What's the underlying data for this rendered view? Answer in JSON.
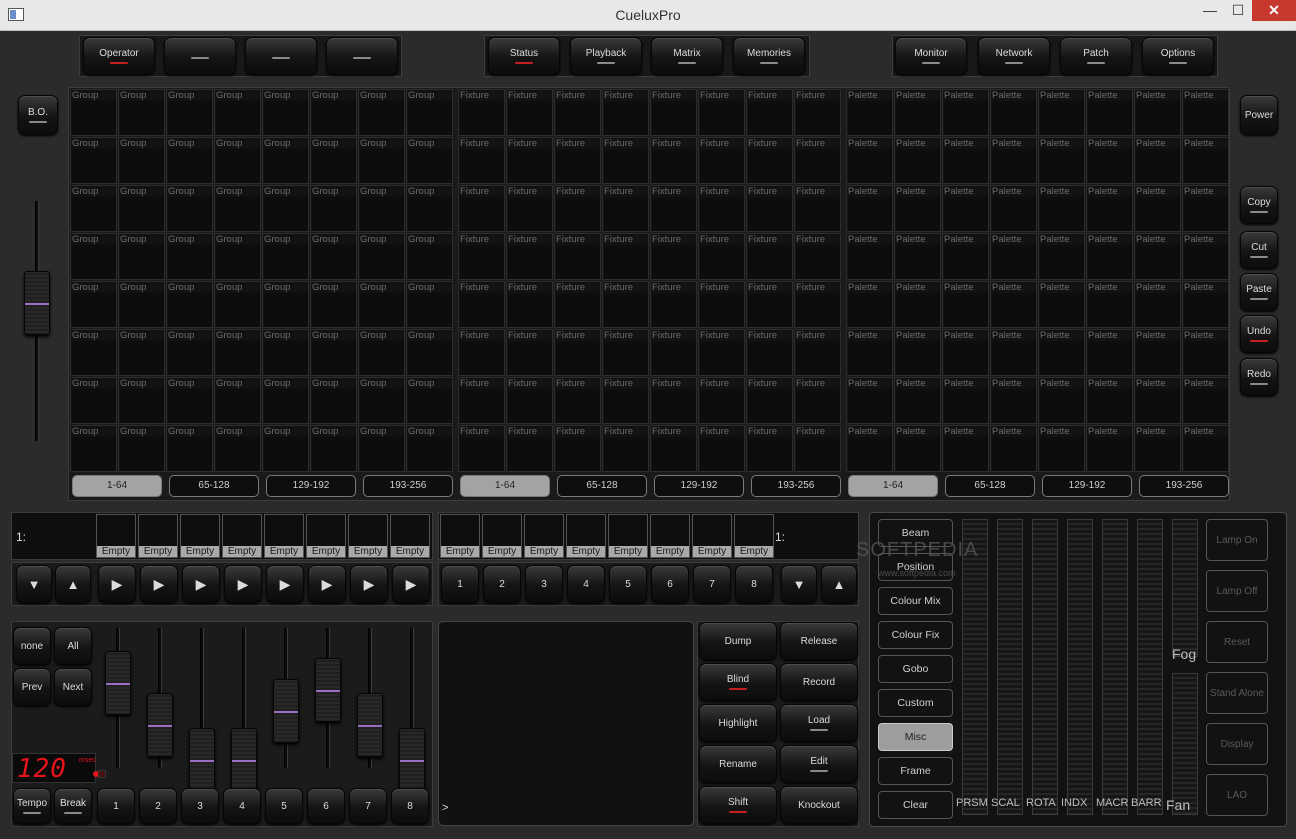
{
  "window": {
    "title": "CueluxPro",
    "min": "—",
    "max": "☐",
    "close": "✕"
  },
  "topbar": {
    "left": [
      {
        "label": "Operator",
        "ind": "red"
      },
      {
        "label": "",
        "ind": "grey"
      },
      {
        "label": "",
        "ind": "grey"
      },
      {
        "label": "",
        "ind": "grey"
      }
    ],
    "middle": [
      {
        "label": "Status",
        "ind": "red"
      },
      {
        "label": "Playback",
        "ind": "grey"
      },
      {
        "label": "Matrix",
        "ind": "grey"
      },
      {
        "label": "Memories",
        "ind": "grey"
      }
    ],
    "right": [
      {
        "label": "Monitor",
        "ind": "grey"
      },
      {
        "label": "Network",
        "ind": "grey"
      },
      {
        "label": "Patch",
        "ind": "grey"
      },
      {
        "label": "Options",
        "ind": "grey"
      }
    ]
  },
  "bo_label": "B.O.",
  "power_label": "Power",
  "edit_buttons": [
    {
      "label": "Copy",
      "ind": "grey"
    },
    {
      "label": "Cut",
      "ind": "grey"
    },
    {
      "label": "Paste",
      "ind": "grey"
    },
    {
      "label": "Undo",
      "ind": "red"
    },
    {
      "label": "Redo",
      "ind": "grey"
    }
  ],
  "grids": [
    {
      "cell_label": "Group",
      "tabs": [
        "1-64",
        "65-128",
        "129-192",
        "193-256"
      ],
      "active_tab": 0
    },
    {
      "cell_label": "Fixture",
      "tabs": [
        "1-64",
        "65-128",
        "129-192",
        "193-256"
      ],
      "active_tab": 0
    },
    {
      "cell_label": "Palette",
      "tabs": [
        "1-64",
        "65-128",
        "129-192",
        "193-256"
      ],
      "active_tab": 0
    }
  ],
  "playback_left": {
    "label": "1:",
    "slots": [
      "Empty",
      "Empty",
      "Empty",
      "Empty",
      "Empty",
      "Empty",
      "Empty",
      "Empty"
    ]
  },
  "playback_right": {
    "label": "1:",
    "slots": [
      "Empty",
      "Empty",
      "Empty",
      "Empty",
      "Empty",
      "Empty",
      "Empty",
      "Empty"
    ]
  },
  "arrows": {
    "down": "▼",
    "up": "▲",
    "play": "▶"
  },
  "number_buttons": [
    "1",
    "2",
    "3",
    "4",
    "5",
    "6",
    "7",
    "8"
  ],
  "selection_buttons": [
    "none",
    "All",
    "Prev",
    "Next"
  ],
  "fader_levels": [
    0.75,
    0.45,
    0.2,
    0.2,
    0.55,
    0.7,
    0.45,
    0.2
  ],
  "master_fader_level": 0.6,
  "tempo": {
    "value": "120",
    "unit": "msec",
    "tempo_label": "Tempo",
    "break_label": "Break"
  },
  "console": {
    "prompt": ">"
  },
  "actions": [
    {
      "label": "Dump",
      "ind": ""
    },
    {
      "label": "Release",
      "ind": ""
    },
    {
      "label": "Blind",
      "ind": "red"
    },
    {
      "label": "Record",
      "ind": ""
    },
    {
      "label": "Highlight",
      "ind": ""
    },
    {
      "label": "Load",
      "ind": "grey"
    },
    {
      "label": "Rename",
      "ind": ""
    },
    {
      "label": "Edit",
      "ind": "grey"
    },
    {
      "label": "Shift",
      "ind": "red"
    },
    {
      "label": "Knockout",
      "ind": ""
    }
  ],
  "categories": {
    "items": [
      "Beam",
      "Position",
      "Colour Mix",
      "Colour Fix",
      "Gobo",
      "Custom",
      "Misc",
      "Frame",
      "Clear"
    ],
    "active": 6
  },
  "meters": [
    "PRSM",
    "SCAL",
    "ROTA",
    "INDX",
    "MACR",
    "BARR",
    "Fan"
  ],
  "fog_label": "Fog",
  "device_buttons": [
    "Lamp On",
    "Lamp Off",
    "Reset",
    "Stand Alone",
    "Display",
    "LAO"
  ],
  "watermark": {
    "brand": "SOFTPEDIA",
    "url": "www.softpedia.com"
  }
}
